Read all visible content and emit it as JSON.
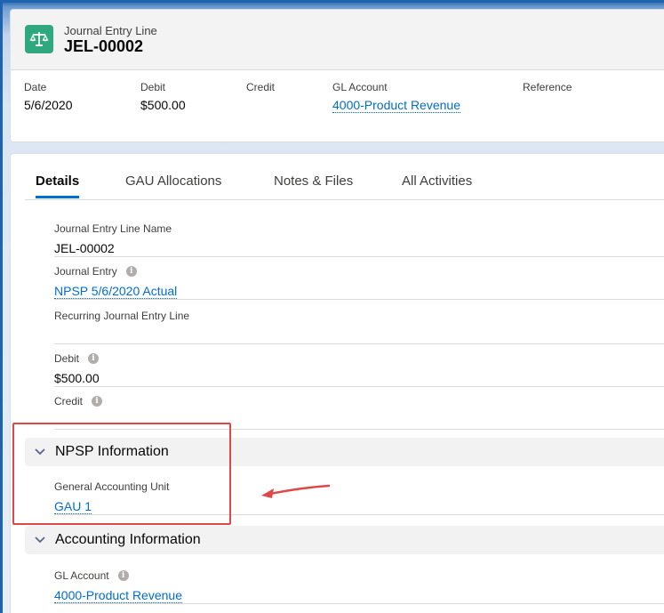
{
  "header": {
    "object_label": "Journal Entry Line",
    "record_name": "JEL-00002",
    "fields": [
      {
        "label": "Date",
        "value": "5/6/2020"
      },
      {
        "label": "Debit",
        "value": "$500.00"
      },
      {
        "label": "Credit",
        "value": ""
      },
      {
        "label": "GL Account",
        "value": "4000-Product Revenue"
      },
      {
        "label": "Reference",
        "value": ""
      }
    ]
  },
  "tabs": [
    "Details",
    "GAU Allocations",
    "Notes & Files",
    "All Activities"
  ],
  "details": {
    "fields": [
      {
        "label": "Journal Entry Line Name",
        "value": "JEL-00002"
      },
      {
        "label": "Journal Entry",
        "value": "NPSP 5/6/2020 Actual"
      },
      {
        "label": "Recurring Journal Entry Line",
        "value": ""
      },
      {
        "label": "Debit",
        "value": "$500.00"
      },
      {
        "label": "Credit",
        "value": ""
      }
    ],
    "npsp_section": {
      "title": "NPSP Information",
      "fields": [
        {
          "label": "General Accounting Unit",
          "value": "GAU 1"
        }
      ]
    },
    "accounting_section": {
      "title": "Accounting Information",
      "fields": [
        {
          "label": "GL Account",
          "value": "4000-Product Revenue"
        }
      ]
    }
  },
  "colors": {
    "record_icon": "#2fa77f",
    "link": "#006dcc",
    "highlight": "#e04848",
    "active_tab": "#0070d2"
  },
  "icons": {
    "record": "scales-icon",
    "info": "info-icon",
    "section_toggle": "chevron-down-icon",
    "annotation": "arrow-left-icon"
  }
}
